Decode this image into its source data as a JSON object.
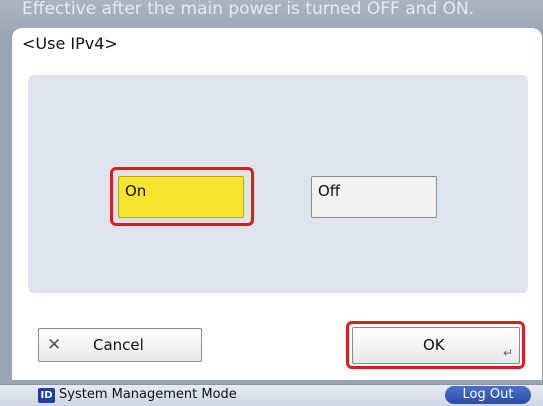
{
  "notice": {
    "text": "Effective after the main power is turned OFF and ON."
  },
  "dialog": {
    "title": "<Use IPv4>"
  },
  "options": {
    "on_label": "On",
    "off_label": "Off",
    "selected": "On"
  },
  "buttons": {
    "cancel_label": "Cancel",
    "ok_label": "OK"
  },
  "footer": {
    "id_icon_text": "ID",
    "mode_label": "System Management Mode",
    "logout_label": "Log Out"
  },
  "icons": {
    "cancel": "close-icon",
    "ok": "enter-icon",
    "mode": "id-icon"
  },
  "colors": {
    "selected_option": "#f6e52e",
    "highlight": "#e01b1b",
    "logout_button": "#2a4ea8"
  }
}
